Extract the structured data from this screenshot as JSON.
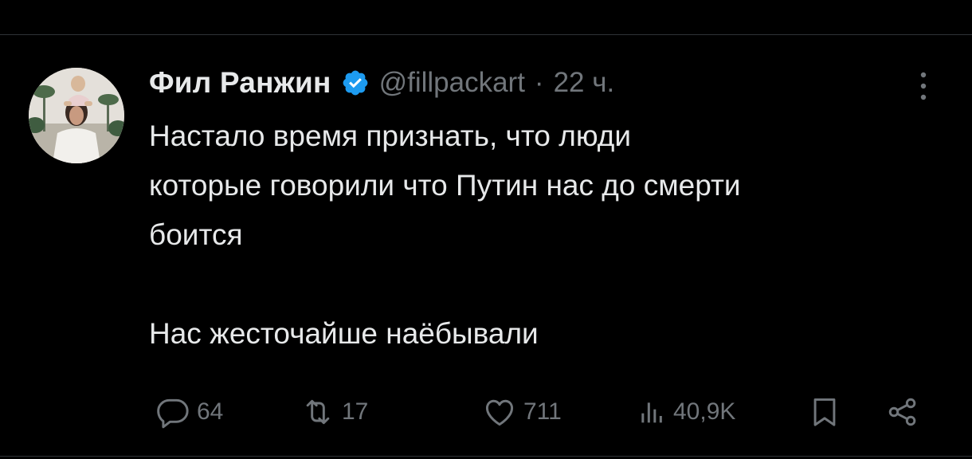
{
  "tweet": {
    "display_name": "Фил Ранжин",
    "handle": "@fillpackart",
    "separator": "·",
    "time": "22 ч.",
    "text": "Настало время признать, что люди\nкоторые говорили что Путин нас до смерти\nбоится\n\nНас жесточайше наёбывали"
  },
  "actions": {
    "replies": "64",
    "retweets": "17",
    "likes": "711",
    "views": "40,9K"
  },
  "icons": {
    "verified": "verified-badge-icon",
    "more": "more-vertical-icon",
    "reply": "reply-icon",
    "retweet": "retweet-icon",
    "like": "heart-icon",
    "views": "views-icon",
    "bookmark": "bookmark-icon",
    "share": "share-icon"
  },
  "colors": {
    "background": "#000000",
    "text_primary": "#e7e9ea",
    "text_secondary": "#71767b",
    "verified_blue": "#1d9bf0",
    "divider": "#2f3336"
  }
}
